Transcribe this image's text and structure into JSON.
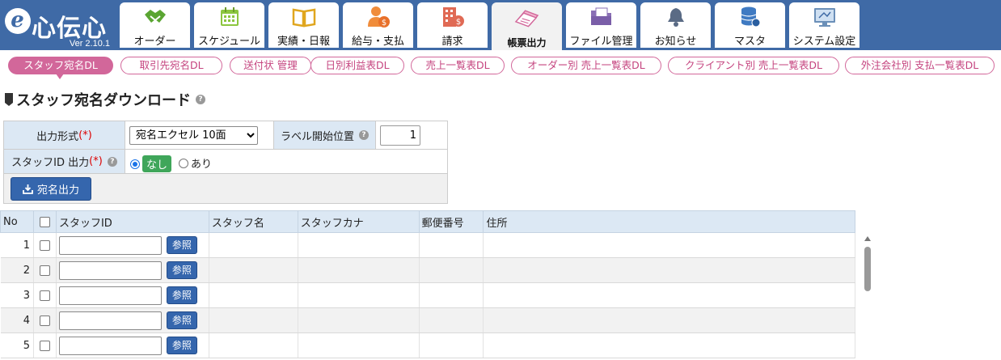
{
  "header": {
    "logo_text": "心伝心",
    "version": "Ver 2.10.1",
    "tabs": [
      {
        "label": "オーダー",
        "icon": "handshake-icon"
      },
      {
        "label": "スケジュール",
        "icon": "calendar-icon"
      },
      {
        "label": "実績・日報",
        "icon": "open-book-icon"
      },
      {
        "label": "給与・支払",
        "icon": "payroll-person-icon"
      },
      {
        "label": "請求",
        "icon": "building-invoice-icon"
      },
      {
        "label": "帳票出力",
        "icon": "document-stack-icon"
      },
      {
        "label": "ファイル管理",
        "icon": "folder-icon"
      },
      {
        "label": "お知らせ",
        "icon": "bell-icon"
      },
      {
        "label": "マスタ",
        "icon": "database-icon"
      },
      {
        "label": "システム設定",
        "icon": "monitor-settings-icon"
      }
    ]
  },
  "subtabs": [
    "スタッフ宛名DL",
    "取引先宛名DL",
    "送付状 管理",
    "日別利益表DL",
    "売上一覧表DL",
    "オーダー別 売上一覧表DL",
    "クライアント別 売上一覧表DL",
    "外注会社別 支払一覧表DL"
  ],
  "page": {
    "title": "スタッフ宛名ダウンロード"
  },
  "form": {
    "output_format_label": "出力形式",
    "required_mark": "(*)",
    "output_format_value": "宛名エクセル 10面",
    "label_start_label": "ラベル開始位置",
    "label_start_value": "1",
    "staff_id_output_label": "スタッフID 出力",
    "radio_none": "なし",
    "radio_yes": "あり",
    "download_button": "宛名出力"
  },
  "grid": {
    "columns": [
      "No",
      "",
      "スタッフID",
      "スタッフ名",
      "スタッフカナ",
      "郵便番号",
      "住所"
    ],
    "ref_button": "参照",
    "rows": [
      "1",
      "2",
      "3",
      "4",
      "5"
    ]
  },
  "colors": {
    "header_bg": "#3f6aa6",
    "subtab_accent": "#d2679a",
    "button_blue": "#3566ad",
    "label_bg": "#dce8f4"
  }
}
